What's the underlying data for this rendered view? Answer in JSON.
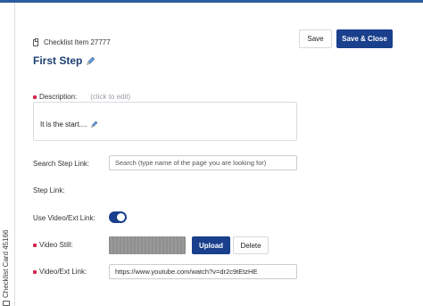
{
  "header": {
    "item_label": "Checklist Item 27777",
    "title": "First Step",
    "save_label": "Save",
    "save_close_label": "Save & Close"
  },
  "side": {
    "label": "Checklist Card 45166"
  },
  "form": {
    "description_label": "Description:",
    "description_hint": "(click to edit)",
    "description_text": "It is the start....",
    "search_step_label": "Search Step Link:",
    "search_step_placeholder": "Search (type name of the page you are looking for)",
    "step_link_label": "Step Link:",
    "use_video_label": "Use Video/Ext Link:",
    "use_video_on": true,
    "video_still_label": "Video Still:",
    "upload_label": "Upload",
    "delete_label": "Delete",
    "video_link_label": "Video/Ext Link:",
    "video_link_value": "https://www.youtube.com/watch?v=dr2c9tEtzHE"
  },
  "colors": {
    "accent": "#1a3f8c",
    "title": "#1e3f73",
    "required": "#d3274e"
  }
}
